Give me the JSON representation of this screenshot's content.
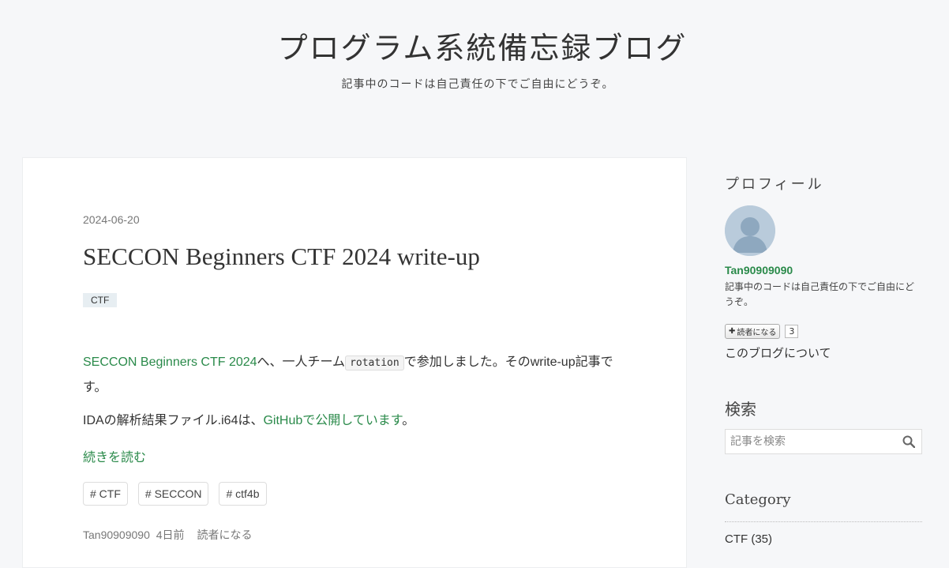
{
  "site": {
    "title": "プログラム系統備忘録ブログ",
    "description": "記事中のコードは自己責任の下でご自由にどうぞ。"
  },
  "entry": {
    "date": "2024-06-20",
    "title": "SECCON Beginners CTF 2024 write-up",
    "category": "CTF",
    "body": {
      "p1_link": "SECCON Beginners CTF 2024",
      "p1_text_a": "へ、一人チーム",
      "p1_code": "rotation",
      "p1_text_b": "で参加しました。そのwrite-up記事です。",
      "p2_text_a": "IDAの解析結果ファイル.i64は、",
      "p2_link": "GitHubで公開しています",
      "p2_text_b": "。"
    },
    "read_more": "続きを読む",
    "tags": [
      "# CTF",
      "# SECCON",
      "# ctf4b"
    ],
    "footer": {
      "author": "Tan90909090",
      "time": "4日前",
      "subscribe": "読者になる"
    }
  },
  "sidebar": {
    "profile": {
      "heading": "プロフィール",
      "name": "Tan90909090",
      "description": "記事中のコードは自己責任の下でご自由にどうぞ。",
      "reader_button": "読者になる",
      "reader_count": "3",
      "about_link": "このブログについて"
    },
    "search": {
      "heading": "検索",
      "placeholder": "記事を検索"
    },
    "category": {
      "heading": "Category",
      "items": [
        "CTF (35)"
      ]
    }
  },
  "colors": {
    "accent": "#2a8a4a",
    "background": "#f6f7f9"
  }
}
